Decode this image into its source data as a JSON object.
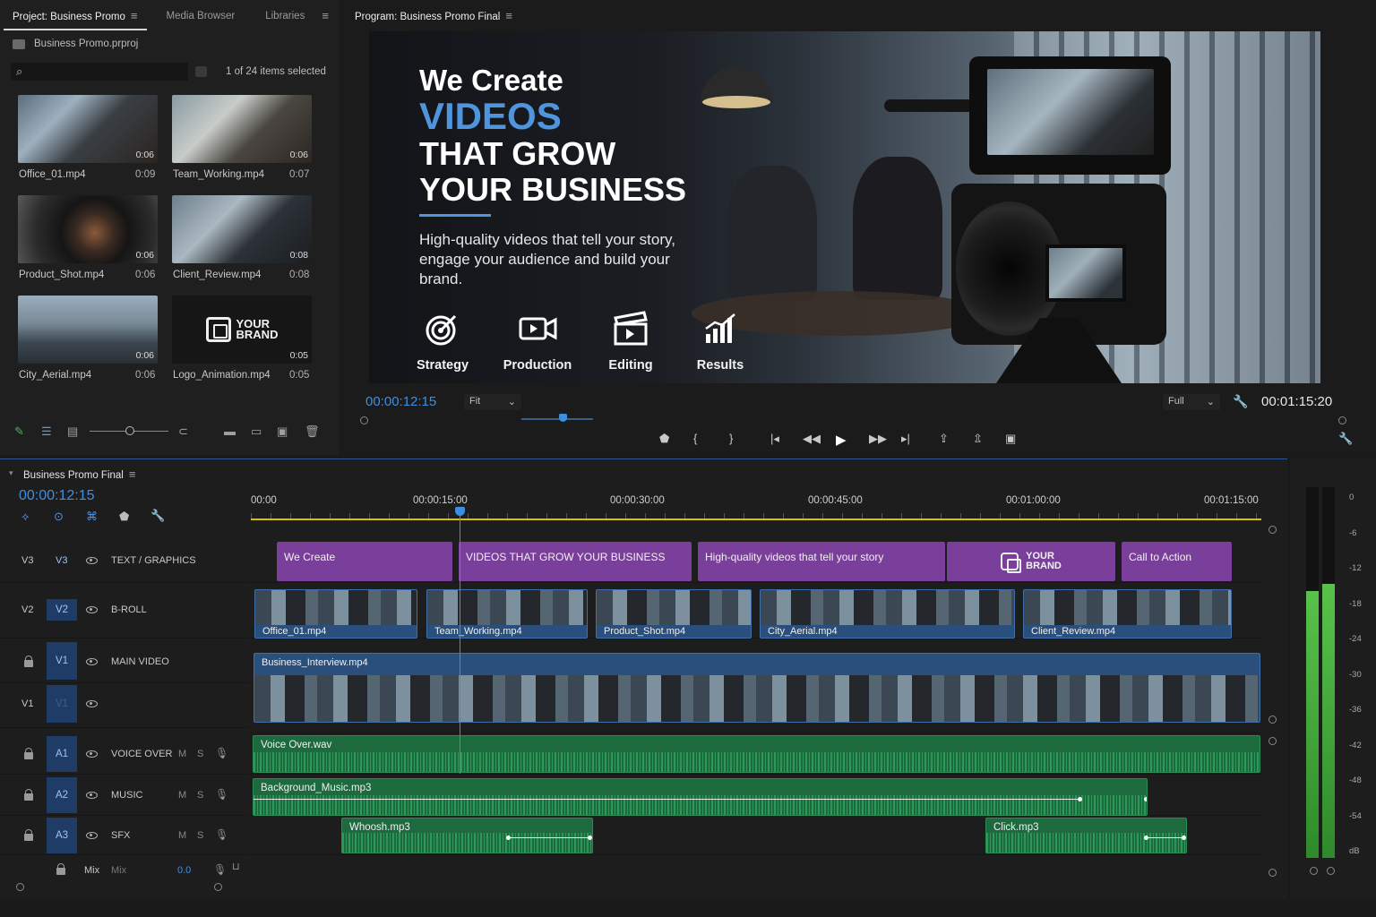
{
  "project": {
    "tabs": [
      "Project: Business Promo",
      "Media Browser",
      "Libraries"
    ],
    "file": "Business Promo.prproj",
    "selection": "1 of 24 items selected",
    "clips": [
      {
        "name": "Office_01.mp4",
        "duration": "0:09",
        "thumb_duration": "0:06"
      },
      {
        "name": "Team_Working.mp4",
        "duration": "0:07",
        "thumb_duration": "0:06"
      },
      {
        "name": "Product_Shot.mp4",
        "duration": "0:06",
        "thumb_duration": "0:06"
      },
      {
        "name": "Client_Review.mp4",
        "duration": "0:08",
        "thumb_duration": "0:08"
      },
      {
        "name": "City_Aerial.mp4",
        "duration": "0:06",
        "thumb_duration": "0:06"
      },
      {
        "name": "Logo_Animation.mp4",
        "duration": "0:05",
        "thumb_duration": "0:05"
      }
    ],
    "logo_text": [
      "YOUR",
      "BRAND"
    ]
  },
  "program": {
    "title": "Program: Business Promo Final",
    "timecode_current": "00:00:12:15",
    "timecode_duration": "00:01:15:20",
    "fit": "Fit",
    "resolution": "Full",
    "video": {
      "headline_1": "We Create",
      "headline_2": "VIDEOS",
      "headline_3": "THAT GROW",
      "headline_4": "YOUR BUSINESS",
      "subtext": "High-quality videos that tell your story, engage your audience and build your brand.",
      "features": [
        "Strategy",
        "Production",
        "Editing",
        "Results"
      ]
    }
  },
  "timeline": {
    "title": "Business Promo Final",
    "timecode": "00:00:12:15",
    "ruler": [
      "00:00",
      "00:00:15:00",
      "00:00:30:00",
      "00:00:45:00",
      "00:01:00:00",
      "00:01:15:00"
    ],
    "tracks": [
      {
        "id": "V3",
        "target": "V3",
        "name": "TEXT / GRAPHICS"
      },
      {
        "id": "V2",
        "target": "V2",
        "name": "B-ROLL"
      },
      {
        "id": "",
        "target": "V1",
        "name": "MAIN VIDEO"
      },
      {
        "id": "V1",
        "target": "V1",
        "name": ""
      },
      {
        "id": "",
        "target": "A1",
        "name": "VOICE OVER"
      },
      {
        "id": "",
        "target": "A2",
        "name": "MUSIC"
      },
      {
        "id": "",
        "target": "A3",
        "name": "SFX"
      }
    ],
    "ms": [
      "M",
      "S"
    ],
    "mix_label": "Mix",
    "mix_sub": "Mix",
    "mix_value": "0.0",
    "v3_clips": [
      "We Create",
      "VIDEOS THAT GROW YOUR BUSINESS",
      "High-quality videos that tell your story",
      "Call to Action"
    ],
    "v3_logo": [
      "YOUR",
      "BRAND"
    ],
    "v2_clips": [
      "Office_01.mp4",
      "Team_Working.mp4",
      "Product_Shot.mp4",
      "City_Aerial.mp4",
      "Client_Review.mp4"
    ],
    "v1_clip": "Business_Interview.mp4",
    "a1_clip": "Voice Over.wav",
    "a2_clip": "Background_Music.mp3",
    "a3_clips": [
      "Whoosh.mp3",
      "Click.mp3"
    ]
  },
  "meters": {
    "scale": [
      "0",
      "-6",
      "-12",
      "-18",
      "-24",
      "-30",
      "-36",
      "-42",
      "-48",
      "-54",
      "dB"
    ],
    "left_level": 0.72,
    "right_level": 0.74
  }
}
